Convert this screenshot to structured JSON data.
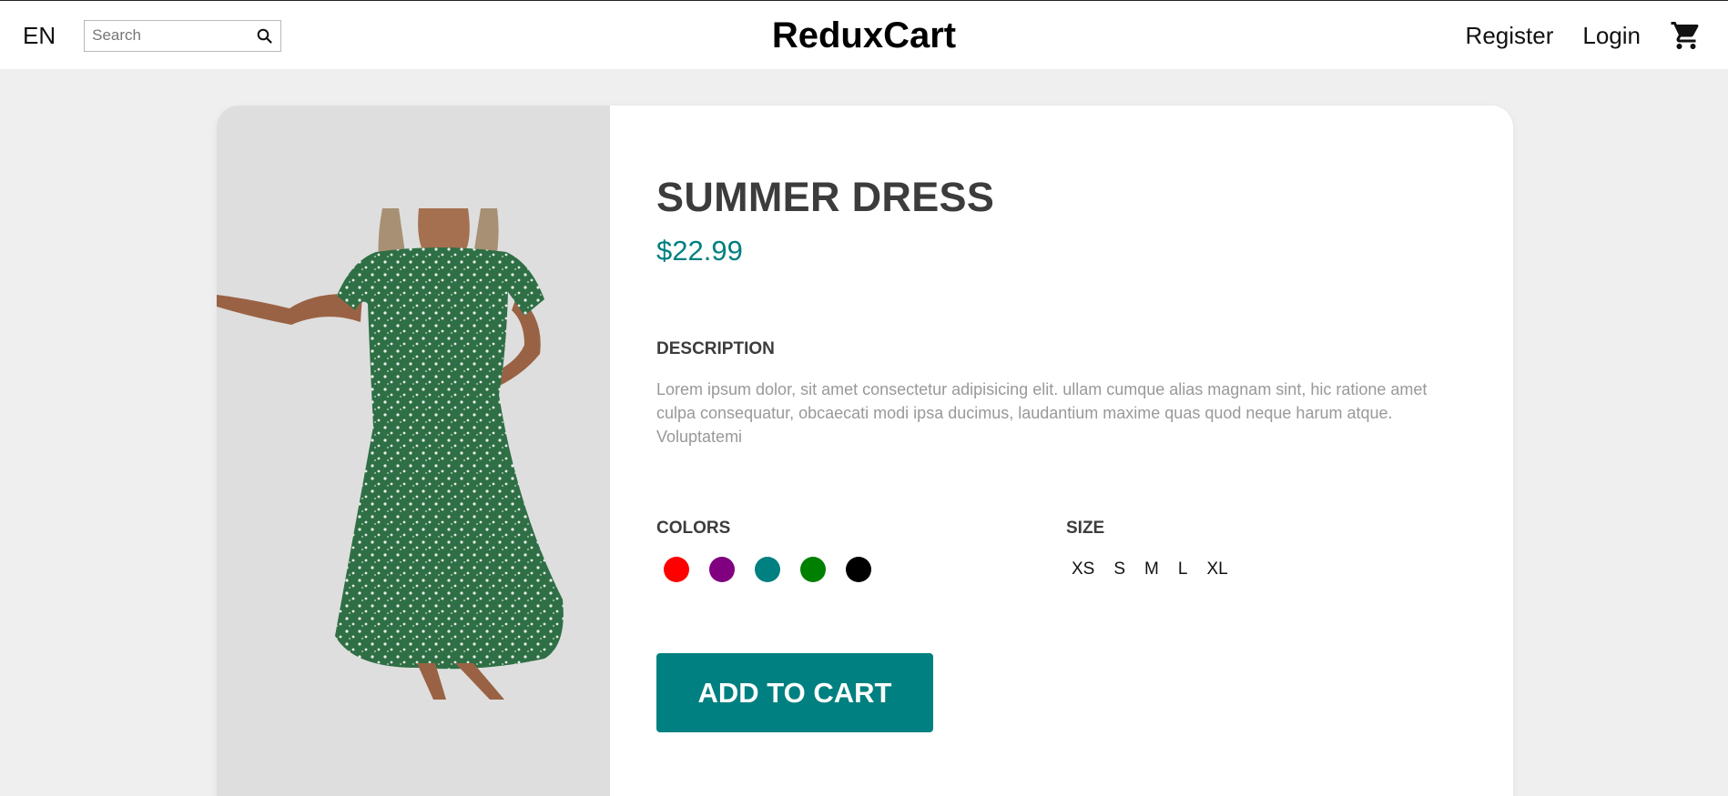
{
  "navbar": {
    "language": "EN",
    "search_placeholder": "Search",
    "logo": "ReduxCart",
    "register_label": "Register",
    "login_label": "Login",
    "icons": {
      "search": "search-icon",
      "cart": "shopping-cart-icon"
    }
  },
  "product": {
    "title": "SUMMER DRESS",
    "price": "$22.99",
    "description_heading": "DESCRIPTION",
    "description": "Lorem ipsum dolor, sit amet consectetur adipisicing elit. ullam cumque alias magnam sint, hic ratione amet culpa consequatur, obcaecati modi ipsa ducimus, laudantium maxime quas quod neque harum atque. Voluptatemi",
    "colors_heading": "COLORS",
    "colors": [
      {
        "name": "red",
        "hex": "#ff0000"
      },
      {
        "name": "purple",
        "hex": "#800080"
      },
      {
        "name": "teal",
        "hex": "#008080"
      },
      {
        "name": "green",
        "hex": "#008000"
      },
      {
        "name": "black",
        "hex": "#000000"
      }
    ],
    "size_heading": "SIZE",
    "sizes": [
      "XS",
      "S",
      "M",
      "L",
      "XL"
    ],
    "add_to_cart_label": "ADD TO CART"
  },
  "theme": {
    "accent": "#008080",
    "page_bg": "#efefef",
    "image_bg": "#dedede"
  }
}
